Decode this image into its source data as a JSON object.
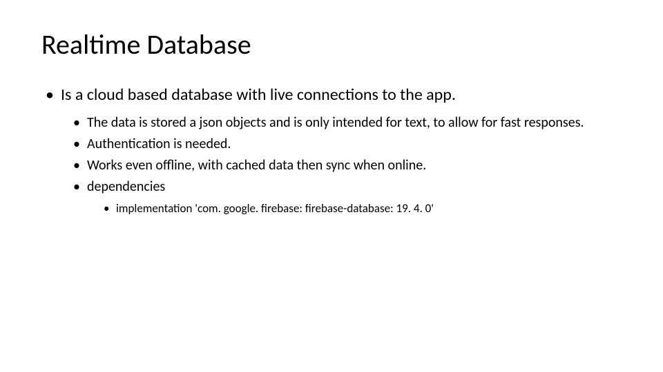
{
  "slide": {
    "title": "Realtime Database",
    "bullets": {
      "item1": "Is a cloud based database with live connections to the app.",
      "sub1": "The data is stored a json objects and is only intended for text, to allow for fast responses.",
      "sub2": "Authentication is needed.",
      "sub3": "Works even offline, with cached data then sync when online.",
      "sub4": "dependencies",
      "subsub1": "implementation 'com. google. firebase: firebase-database: 19. 4. 0'"
    }
  }
}
